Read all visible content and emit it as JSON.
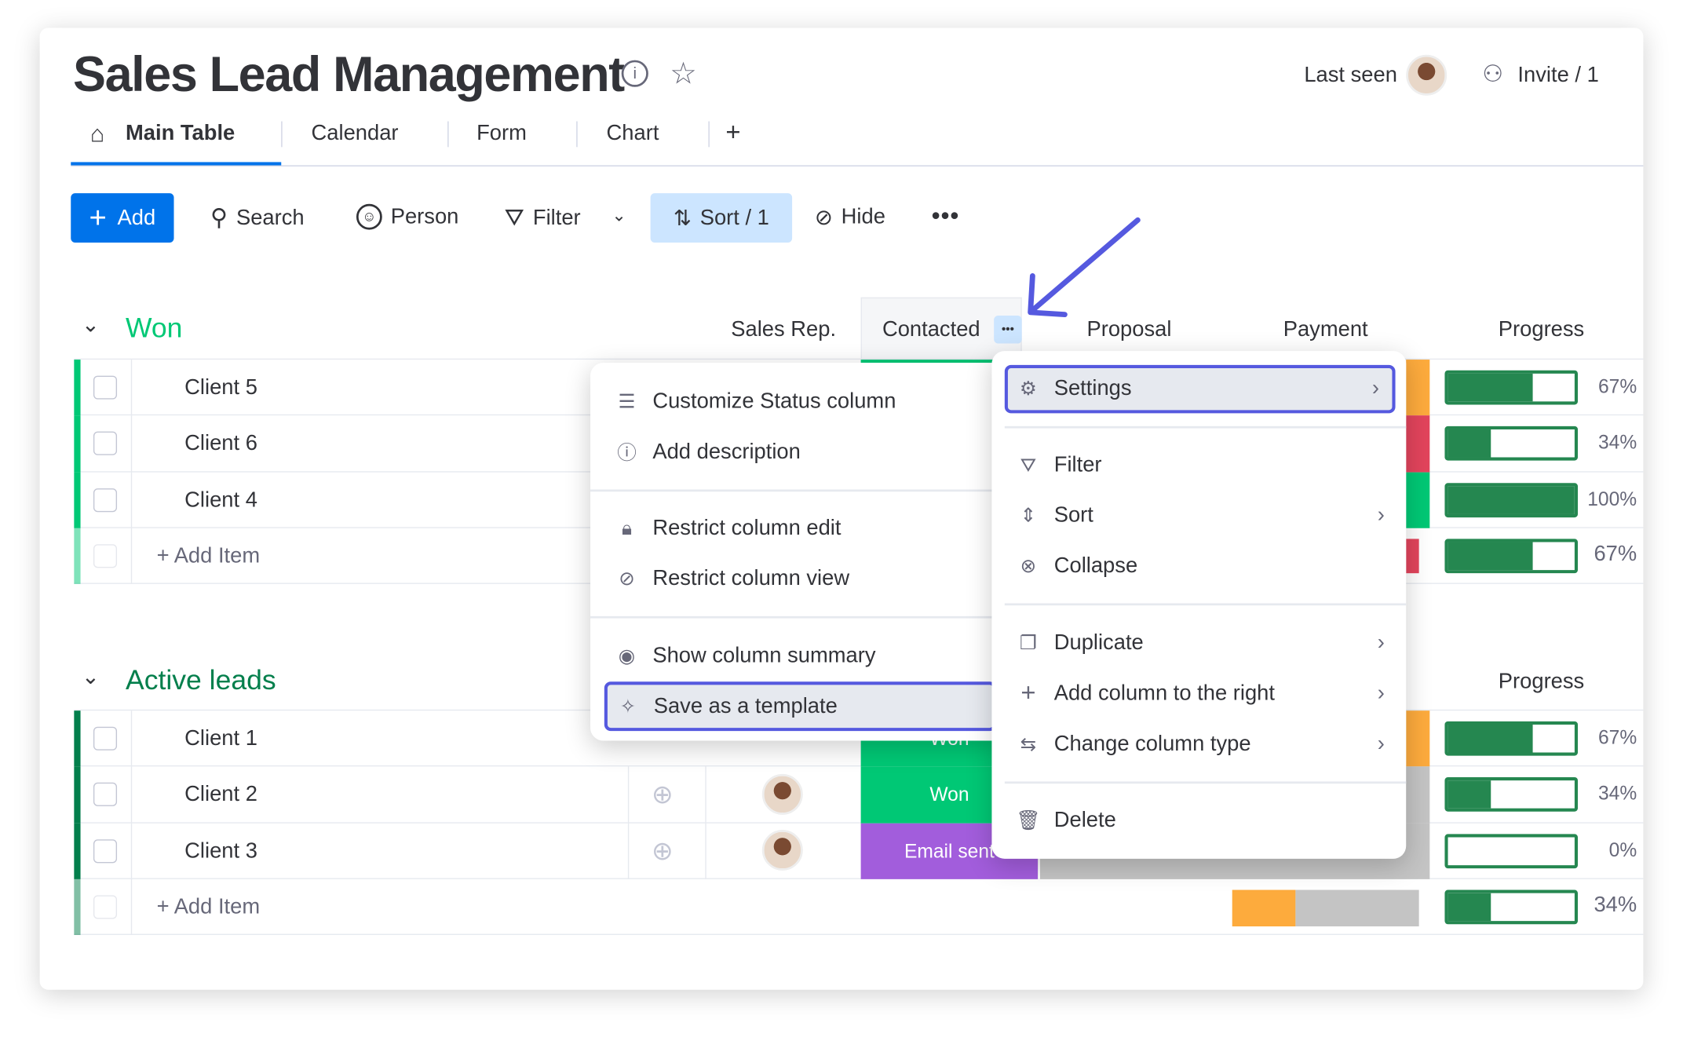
{
  "header": {
    "title": "Sales Lead Management",
    "last_seen": "Last seen",
    "invite": "Invite / 1"
  },
  "tabs": [
    {
      "label": "Main Table",
      "active": true
    },
    {
      "label": "Calendar"
    },
    {
      "label": "Form"
    },
    {
      "label": "Chart"
    },
    {
      "label": "+"
    }
  ],
  "toolbar": {
    "add": "Add",
    "search": "Search",
    "person": "Person",
    "filter": "Filter",
    "sort": "Sort / 1",
    "hide": "Hide",
    "more": "•••"
  },
  "columns": {
    "sales_rep": "Sales Rep.",
    "contacted": "Contacted",
    "proposal": "Proposal",
    "payment": "Payment",
    "progress": "Progress"
  },
  "groups": [
    {
      "name": "Won",
      "color": "#00c875",
      "rows": [
        {
          "name": "Client 5",
          "progress": 67,
          "progress_label": "67%"
        },
        {
          "name": "Client 6",
          "progress": 34,
          "progress_label": "34%"
        },
        {
          "name": "Client 4",
          "progress": 100,
          "progress_label": "100%"
        }
      ],
      "add_item": "+ Add Item",
      "summary_progress": 67,
      "summary_label": "67%"
    },
    {
      "name": "Active leads",
      "color": "#037f4c",
      "rows": [
        {
          "name": "Client 1",
          "status": "Won",
          "progress": 67,
          "progress_label": "67%"
        },
        {
          "name": "Client 2",
          "status": "Won",
          "progress": 34,
          "progress_label": "34%"
        },
        {
          "name": "Client 3",
          "status": "Email sent",
          "progress": 0,
          "progress_label": "0%"
        }
      ],
      "add_item": "+ Add Item",
      "summary_progress": 34,
      "summary_label": "34%"
    }
  ],
  "column_menu": {
    "items": [
      "Customize Status column",
      "Add description",
      "Restrict column edit",
      "Restrict column view",
      "Show column summary",
      "Save as a template"
    ],
    "highlighted": "Save as a template"
  },
  "settings_menu": {
    "items": [
      "Settings",
      "Filter",
      "Sort",
      "Collapse",
      "Duplicate",
      "Add column to the right",
      "Change column type",
      "Delete"
    ],
    "highlighted": "Settings"
  },
  "colors": {
    "primary": "#0073ea",
    "won": "#00c875",
    "active": "#037f4c",
    "email_sent": "#a25ddc",
    "working": "#fdab3d",
    "stuck": "#e2445c",
    "progress": "#258750",
    "highlight": "#5559df"
  }
}
